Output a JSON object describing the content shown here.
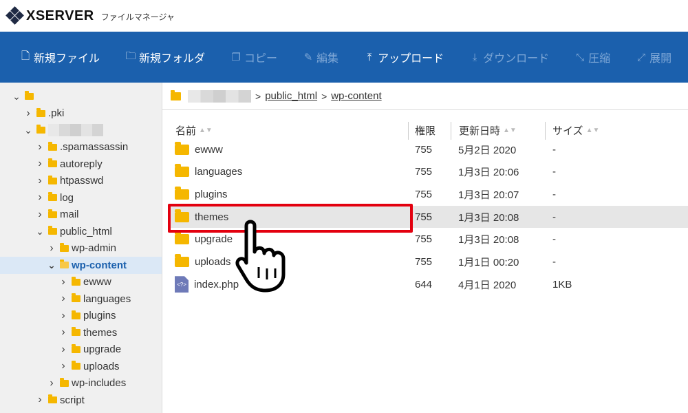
{
  "app": {
    "logo": "XSERVER",
    "subtitle": "ファイルマネージャ"
  },
  "toolbar": {
    "buttons": [
      {
        "label": "新規ファイル",
        "icon": "new-file-icon",
        "enabled": true
      },
      {
        "label": "新規フォルダ",
        "icon": "new-folder-icon",
        "enabled": true
      },
      {
        "label": "コピー",
        "icon": "copy-icon",
        "enabled": false
      },
      {
        "label": "編集",
        "icon": "edit-icon",
        "enabled": false
      },
      {
        "label": "アップロード",
        "icon": "upload-icon",
        "enabled": true
      },
      {
        "label": "ダウンロード",
        "icon": "download-icon",
        "enabled": false
      },
      {
        "label": "圧縮",
        "icon": "compress-icon",
        "enabled": false
      },
      {
        "label": "展開",
        "icon": "extract-icon",
        "enabled": false
      }
    ]
  },
  "tree": [
    {
      "label": "",
      "depth": 0,
      "expanded": true
    },
    {
      "label": ".pki",
      "depth": 1,
      "expanded": false
    },
    {
      "label": "",
      "depth": 1,
      "expanded": true,
      "redacted": true
    },
    {
      "label": ".spamassassin",
      "depth": 2,
      "expanded": false
    },
    {
      "label": "autoreply",
      "depth": 2,
      "expanded": false
    },
    {
      "label": "htpasswd",
      "depth": 2,
      "expanded": false
    },
    {
      "label": "log",
      "depth": 2,
      "expanded": false
    },
    {
      "label": "mail",
      "depth": 2,
      "expanded": false
    },
    {
      "label": "public_html",
      "depth": 2,
      "expanded": true
    },
    {
      "label": "wp-admin",
      "depth": 3,
      "expanded": false
    },
    {
      "label": "wp-content",
      "depth": 3,
      "expanded": true,
      "selected": true
    },
    {
      "label": "ewww",
      "depth": 4,
      "expanded": false
    },
    {
      "label": "languages",
      "depth": 4,
      "expanded": false
    },
    {
      "label": "plugins",
      "depth": 4,
      "expanded": false
    },
    {
      "label": "themes",
      "depth": 4,
      "expanded": false
    },
    {
      "label": "upgrade",
      "depth": 4,
      "expanded": false
    },
    {
      "label": "uploads",
      "depth": 4,
      "expanded": false
    },
    {
      "label": "wp-includes",
      "depth": 3,
      "expanded": false
    },
    {
      "label": "script",
      "depth": 2,
      "expanded": false
    }
  ],
  "breadcrumb": {
    "items": [
      "public_html",
      "wp-content"
    ]
  },
  "columns": {
    "name": "名前",
    "perm": "権限",
    "date": "更新日時",
    "size": "サイズ"
  },
  "files": [
    {
      "name": "ewww",
      "type": "folder",
      "perm": "755",
      "date": "5月2日 2020",
      "size": "-"
    },
    {
      "name": "languages",
      "type": "folder",
      "perm": "755",
      "date": "1月3日 20:06",
      "size": "-"
    },
    {
      "name": "plugins",
      "type": "folder",
      "perm": "755",
      "date": "1月3日 20:07",
      "size": "-"
    },
    {
      "name": "themes",
      "type": "folder",
      "perm": "755",
      "date": "1月3日 20:08",
      "size": "-",
      "highlighted": true
    },
    {
      "name": "upgrade",
      "type": "folder",
      "perm": "755",
      "date": "1月3日 20:08",
      "size": "-"
    },
    {
      "name": "uploads",
      "type": "folder",
      "perm": "755",
      "date": "1月1日 00:20",
      "size": "-"
    },
    {
      "name": "index.php",
      "type": "php",
      "perm": "644",
      "date": "4月1日 2020",
      "size": "1KB"
    }
  ],
  "colors": {
    "toolbar": "#1b60ad",
    "highlight": "#e3000f",
    "folder": "#f5b700"
  }
}
